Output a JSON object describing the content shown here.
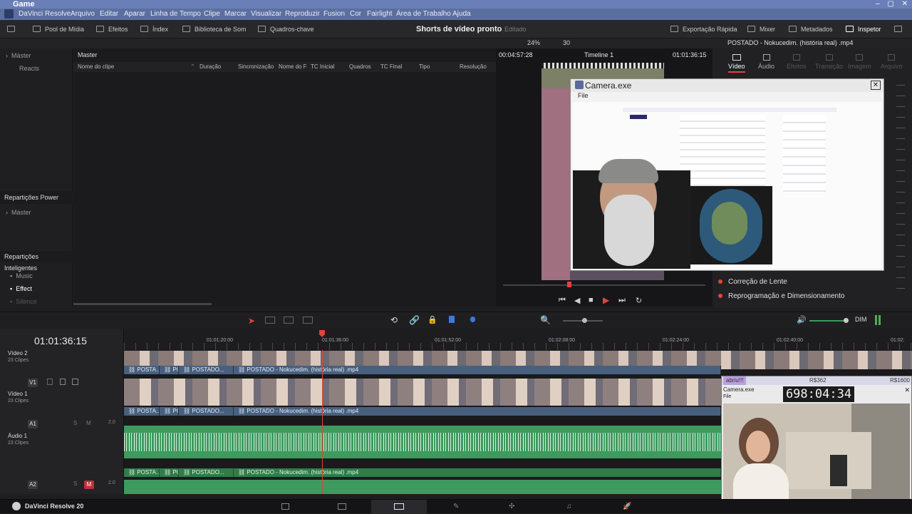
{
  "titlebar": {
    "title": "Game",
    "controls": [
      "–",
      "▢",
      "✕"
    ]
  },
  "menu": [
    "DaVinci Resolve",
    "Arquivo",
    "Editar",
    "Aparar",
    "Linha de Tempo",
    "Clipe",
    "Marcar",
    "Visualizar",
    "Reproduzir",
    "Fusion",
    "Cor",
    "Fairlight",
    "Área de Trabalho",
    "Ajuda"
  ],
  "toolbar": {
    "left": [
      "Pool de Mídia",
      "Efeitos",
      "Índex",
      "Biblioteca de Som",
      "Quadros-chave"
    ],
    "project_title": "Shorts de vídeo pronto",
    "project_status": "Editado",
    "right": [
      "Exportação Rápida",
      "Mixer",
      "Metadados",
      "Inspetor"
    ]
  },
  "viewer_bar": {
    "zoom": "24%",
    "fps": "30",
    "source_timecode": "00:04:57:28",
    "timeline_name": "Timeline 1",
    "record_timecode": "01:01:36:15",
    "clip_name": "POSTADO - Nokucedim. (história real) .mp4"
  },
  "bins": {
    "master": "Máster",
    "reacts": "Reacts",
    "power_header": "Repartições Power",
    "power_master": "Máster",
    "smart_header": "Repartições Inteligentes",
    "smart_items": [
      "Music",
      "Effect",
      "Silence"
    ]
  },
  "clip_list": {
    "breadcrumb": "Master",
    "columns": [
      "Nome do clipe",
      "Duração",
      "Sincronização",
      "Nome do F",
      "TC Inicial",
      "Quadros",
      "TC Final",
      "Tipo",
      "Resolução"
    ]
  },
  "inspector": {
    "tabs": [
      "Vídeo",
      "Áudio",
      "Efeitos",
      "Transição",
      "Imagem",
      "Arquivo"
    ],
    "sections": [
      "Correção de Lente",
      "Reprogramação e Dimensionamento"
    ]
  },
  "popup": {
    "title": "Camera.exe",
    "menu": "File"
  },
  "timeline": {
    "timecode": "01:01:36:15",
    "ruler": [
      "01:01:20:00",
      "01:01:36:00",
      "01:01:52:00",
      "01:02:08:00",
      "01:02:24:00",
      "01:02:40:00",
      "01:02:"
    ],
    "dim_label": "DIM",
    "tracks": [
      {
        "id": "V2",
        "name": "Vídeo 2",
        "count": "23 Clipes"
      },
      {
        "id": "V1",
        "name": "Vídeo 1",
        "count": "23 Clipes"
      },
      {
        "id": "A1",
        "name": "Áudio 1",
        "count": "23 Clipes",
        "level": "2.0"
      },
      {
        "id": "A2",
        "name": "",
        "count": "",
        "level": "2.0"
      }
    ],
    "clip_labels": [
      "POSTA...",
      "PO...",
      "POSTADO...",
      "POSTADO - Nokucedim. (história real) .mp4"
    ]
  },
  "overlay": {
    "top_left": "abriu!!!",
    "top_mid": "R$362",
    "top_right": "R$1600",
    "title": "Camera.exe",
    "file": "File",
    "counter": "698:04:34"
  },
  "taskbar": {
    "app_name": "DaVinci Resolve 20"
  },
  "colors": {
    "accent_red": "#e0443a",
    "clip_blue": "#48607e",
    "audio_green": "#3e9a5e",
    "menu_blue": "#5b6f9f"
  }
}
